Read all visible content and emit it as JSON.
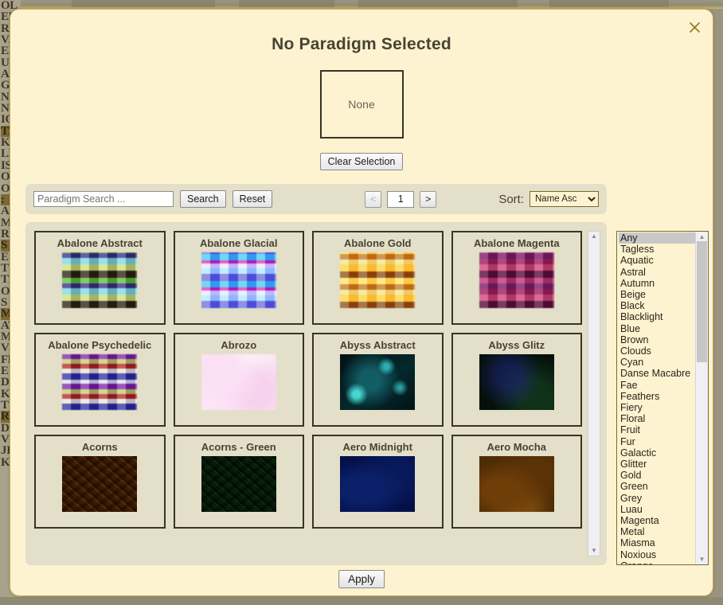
{
  "backdrop": {
    "left_column_lines": [
      "OL",
      "EM",
      "R",
      "V/",
      "EI",
      "U",
      "A",
      "G",
      "N",
      "NI",
      "IO",
      "TH",
      "K",
      "LI",
      "IS",
      "O",
      "O",
      ":",
      "A",
      "M",
      "R",
      "",
      "S",
      "E",
      "T",
      "TI",
      "O",
      "S",
      "ME",
      "",
      "AT",
      "M",
      "V?",
      "FF",
      "E",
      "D",
      "K",
      "T",
      "RE",
      "DI",
      "VC",
      "JI",
      "KS",
      ""
    ],
    "highlight_indices": [
      11,
      17,
      22,
      28,
      38
    ],
    "top_text": "OL OF PUMAS"
  },
  "dialog": {
    "title": "No Paradigm Selected",
    "close_icon": "close-icon",
    "preview_label": "None",
    "clear_button": "Clear Selection",
    "apply_button": "Apply"
  },
  "toolbar": {
    "search_placeholder": "Paradigm Search ...",
    "search_value": "",
    "search_button": "Search",
    "reset_button": "Reset",
    "prev_page": "<",
    "page_number": "1",
    "next_page": ">",
    "sort_label": "Sort:",
    "sort_selected": "Name Asc",
    "sort_options": [
      "Name Asc",
      "Name Desc"
    ]
  },
  "results": {
    "tiles": [
      {
        "name": "Abalone Abstract",
        "swatch": "tx-abalone-abstract"
      },
      {
        "name": "Abalone Glacial",
        "swatch": "tx-abalone-glacial"
      },
      {
        "name": "Abalone Gold",
        "swatch": "tx-abalone-gold"
      },
      {
        "name": "Abalone Magenta",
        "swatch": "tx-abalone-magenta"
      },
      {
        "name": "Abalone Psychedelic",
        "swatch": "tx-abalone-psychedelic"
      },
      {
        "name": "Abrozo",
        "swatch": "tx-abrozo"
      },
      {
        "name": "Abyss Abstract",
        "swatch": "tx-abyss-abstract"
      },
      {
        "name": "Abyss Glitz",
        "swatch": "tx-abyss-glitz"
      },
      {
        "name": "Acorns",
        "swatch": "tx-acorns"
      },
      {
        "name": "Acorns - Green",
        "swatch": "tx-acorns-green"
      },
      {
        "name": "Aero Midnight",
        "swatch": "tx-aero-midnight"
      },
      {
        "name": "Aero Mocha",
        "swatch": "tx-aero-mocha"
      }
    ]
  },
  "tag_filter": {
    "selected": "Any",
    "options": [
      "Any",
      "Tagless",
      "Aquatic",
      "Astral",
      "Autumn",
      "Beige",
      "Black",
      "Blacklight",
      "Blue",
      "Brown",
      "Clouds",
      "Cyan",
      "Danse Macabre",
      "Fae",
      "Feathers",
      "Fiery",
      "Floral",
      "Fruit",
      "Fur",
      "Galactic",
      "Glitter",
      "Gold",
      "Green",
      "Grey",
      "Luau",
      "Magenta",
      "Metal",
      "Miasma",
      "Noxious",
      "Orange"
    ]
  },
  "colors": {
    "modal_bg": "#fdf3d1",
    "modal_border": "#c9ab54",
    "panel_bg": "#e3dfc8",
    "text": "#4a4233",
    "close_icon": "#9a7b2c",
    "backdrop": "#9a9481"
  }
}
